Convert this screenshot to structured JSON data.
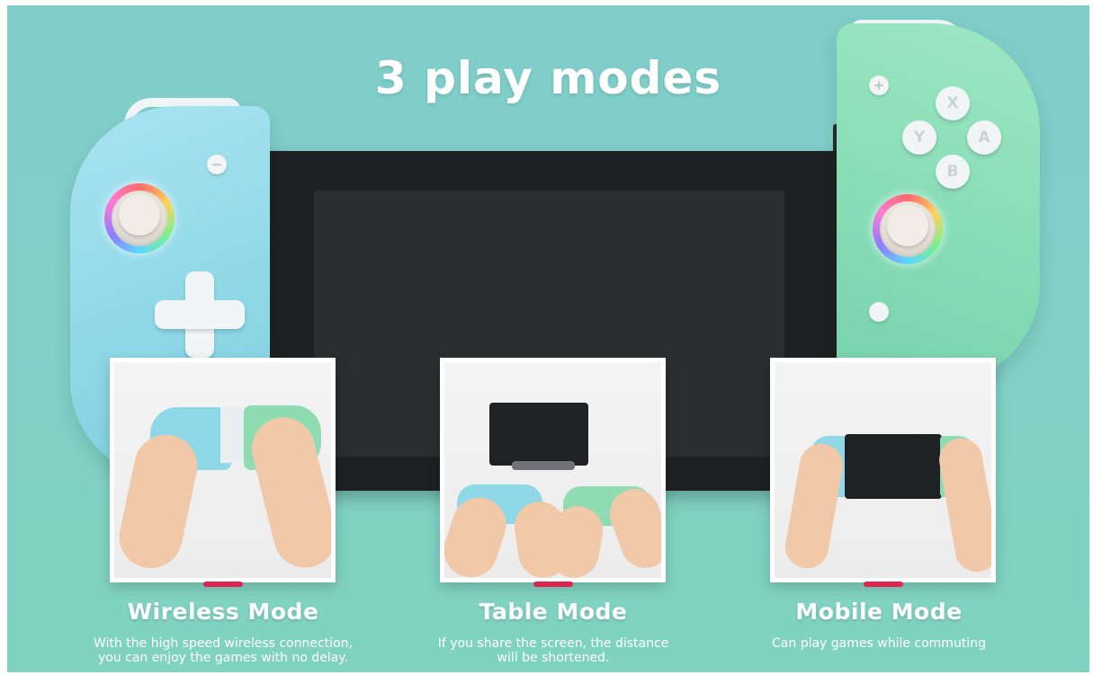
{
  "headline": "3 play modes",
  "modes": [
    {
      "title": "Wireless Mode",
      "description_lines": [
        "With the high speed wireless connection,",
        "you can  enjoy the games with no delay."
      ]
    },
    {
      "title": "Table Mode",
      "description_lines": [
        "If you share the screen, the distance",
        "will be shortened."
      ]
    },
    {
      "title": "Mobile Mode",
      "description_lines": [
        "Can play games while commuting"
      ]
    }
  ],
  "controller_buttons": {
    "minus": "−",
    "plus": "+",
    "x": "X",
    "y": "Y",
    "a": "A",
    "b": "B"
  },
  "colors": {
    "background": "#80cfc6",
    "left_controller": "#8fd8e7",
    "right_controller": "#86ddb6",
    "accent_bar": "#e0244f",
    "text": "#ffffff"
  }
}
